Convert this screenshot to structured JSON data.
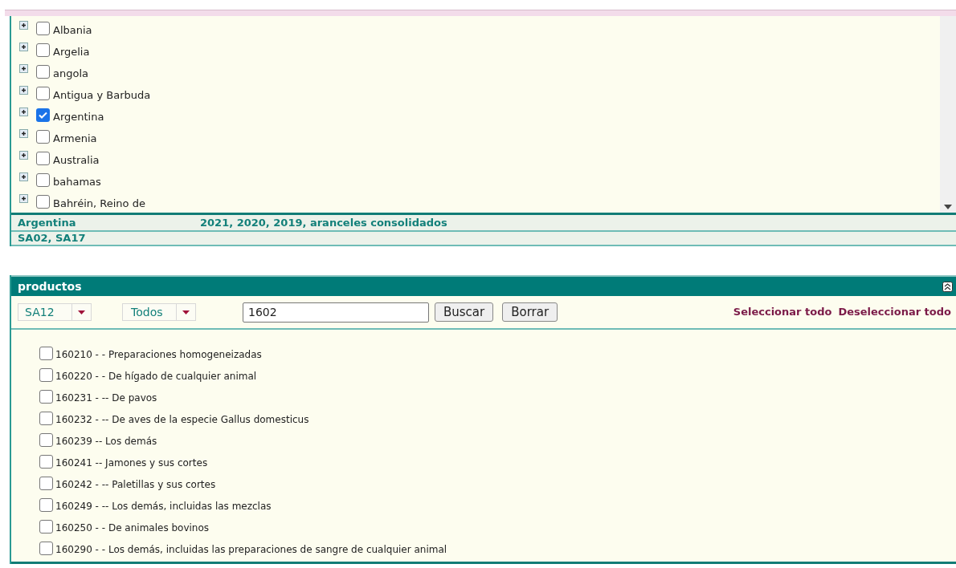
{
  "countries": [
    {
      "name": "Albania",
      "checked": false
    },
    {
      "name": "Argelia",
      "checked": false
    },
    {
      "name": "angola",
      "checked": false
    },
    {
      "name": "Antigua y Barbuda",
      "checked": false
    },
    {
      "name": "Argentina",
      "checked": true
    },
    {
      "name": "Armenia",
      "checked": false
    },
    {
      "name": "Australia",
      "checked": false
    },
    {
      "name": "bahamas",
      "checked": false
    },
    {
      "name": "Bahréin, Reino de",
      "checked": false
    }
  ],
  "summary": {
    "country": "Argentina",
    "years": "2021, 2020, 2019, aranceles consolidados",
    "nomenclatures": "SA02, SA17"
  },
  "products_panel": {
    "title": "productos",
    "nomenclature_select": "SA12",
    "scope_select": "Todos",
    "search_value": "1602",
    "search_button": "Buscar",
    "clear_button": "Borrar",
    "select_all": "Seleccionar todo",
    "deselect_all": "Deseleccionar todo",
    "items": [
      {
        "label": "160210 - - Preparaciones homogeneizadas",
        "checked": false
      },
      {
        "label": "160220 - - De hígado de cualquier animal",
        "checked": false
      },
      {
        "label": "160231 - -- De pavos",
        "checked": false
      },
      {
        "label": "160232 - -- De aves de la especie Gallus domesticus",
        "checked": false
      },
      {
        "label": "160239 -- Los demás",
        "checked": false
      },
      {
        "label": "160241 -- Jamones y sus cortes",
        "checked": false
      },
      {
        "label": "160242 - -- Paletillas y sus cortes",
        "checked": false
      },
      {
        "label": "160249 - -- Los demás, incluidas las mezclas",
        "checked": false
      },
      {
        "label": "160250 - - De animales bovinos",
        "checked": false
      },
      {
        "label": "160290 - - Los demás, incluidas las preparaciones de sangre de cualquier animal",
        "checked": false
      }
    ]
  }
}
